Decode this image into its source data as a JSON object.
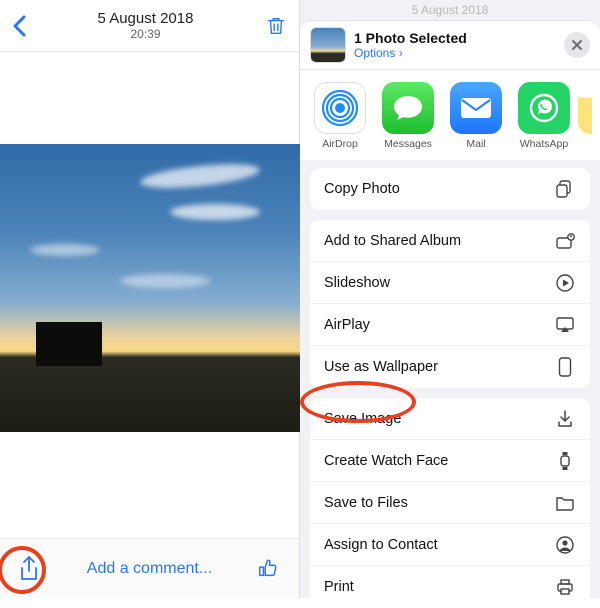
{
  "left": {
    "date": "5 August 2018",
    "time": "20:39",
    "comment_placeholder": "Add a comment..."
  },
  "right": {
    "ghost_date": "5 August 2018",
    "selected_title": "1 Photo Selected",
    "options_label": "Options ›",
    "apps": {
      "airdrop": "AirDrop",
      "messages": "Messages",
      "mail": "Mail",
      "whatsapp": "WhatsApp"
    },
    "actions": {
      "copy": "Copy Photo",
      "shared_album": "Add to Shared Album",
      "slideshow": "Slideshow",
      "airplay": "AirPlay",
      "wallpaper": "Use as Wallpaper",
      "save_image": "Save Image",
      "watch_face": "Create Watch Face",
      "save_files": "Save to Files",
      "assign_contact": "Assign to Contact",
      "print": "Print"
    }
  }
}
